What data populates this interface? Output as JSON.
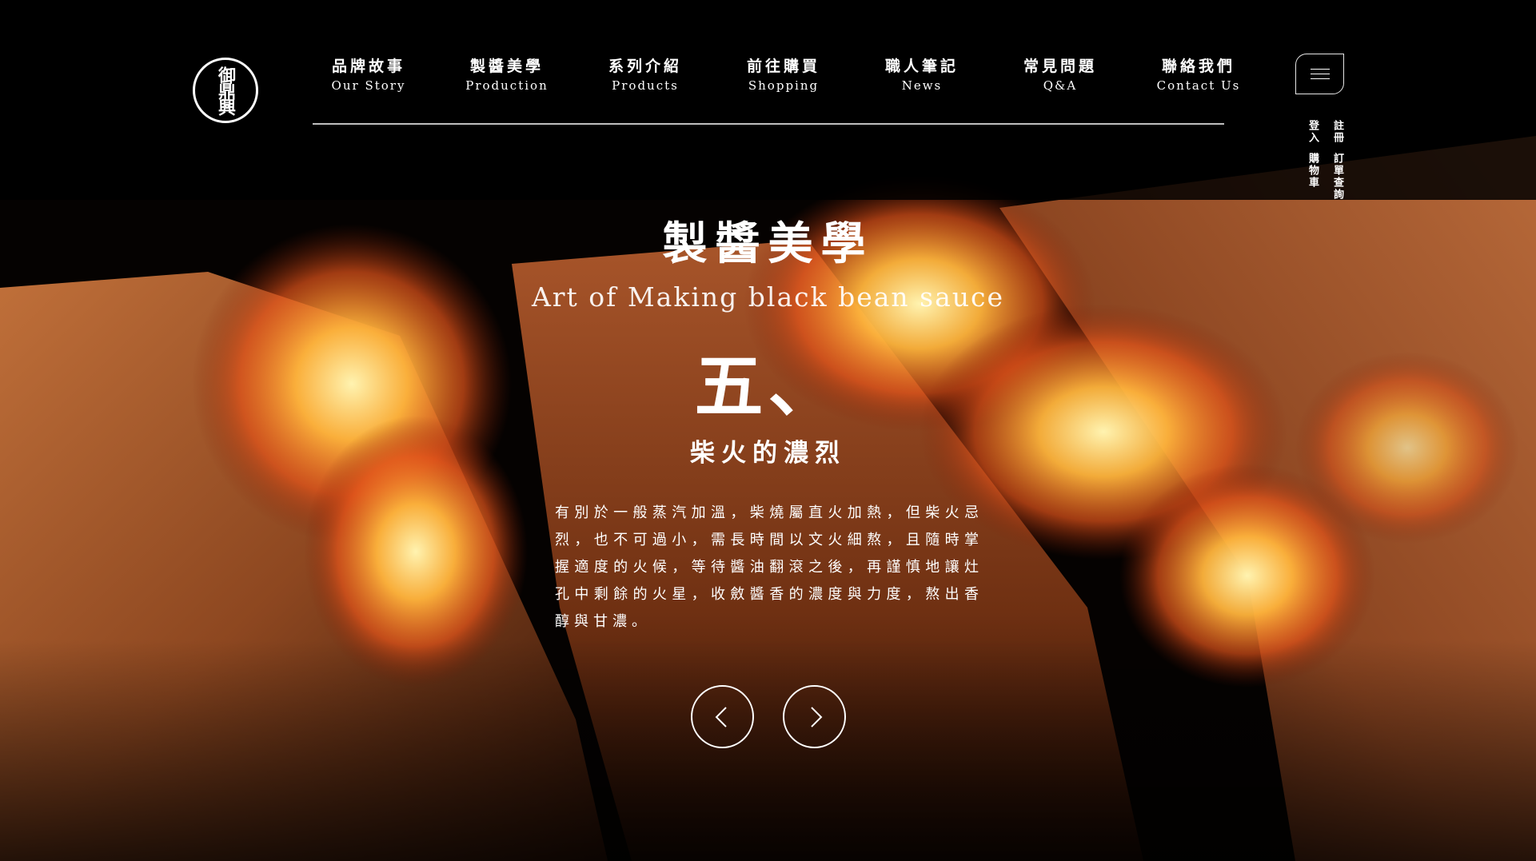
{
  "brand": {
    "logo_text": "御鼎興"
  },
  "nav": {
    "items": [
      {
        "zh": "品牌故事",
        "en": "Our Story"
      },
      {
        "zh": "製醬美學",
        "en": "Production"
      },
      {
        "zh": "系列介紹",
        "en": "Products"
      },
      {
        "zh": "前往購買",
        "en": "Shopping"
      },
      {
        "zh": "職人筆記",
        "en": "News"
      },
      {
        "zh": "常見問題",
        "en": "Q&A"
      },
      {
        "zh": "聯絡我們",
        "en": "Contact Us"
      }
    ]
  },
  "utility": {
    "register": "註冊",
    "login": "登入",
    "order_lookup": "訂單查詢",
    "cart": "購物車"
  },
  "hero": {
    "title": "製醬美學",
    "subtitle": "Art of Making black bean sauce",
    "step_number": "五、",
    "step_title": "柴火的濃烈",
    "step_body": "有別於一般蒸汽加溫，柴燒屬直火加熱，但柴火忌烈，也不可過小，需長時間以文火細熬，且隨時掌握適度的火候，等待醬油翻滾之後，再謹慎地讓灶孔中剩餘的火星，收斂醬香的濃度與力度，熬出香醇與甘濃。"
  },
  "controls": {
    "prev_icon": "chevron-left-icon",
    "next_icon": "chevron-right-icon"
  },
  "colors": {
    "background": "#000000",
    "text": "#ffffff",
    "fire": "#ff9a2e",
    "wood": "#8a4a22"
  }
}
